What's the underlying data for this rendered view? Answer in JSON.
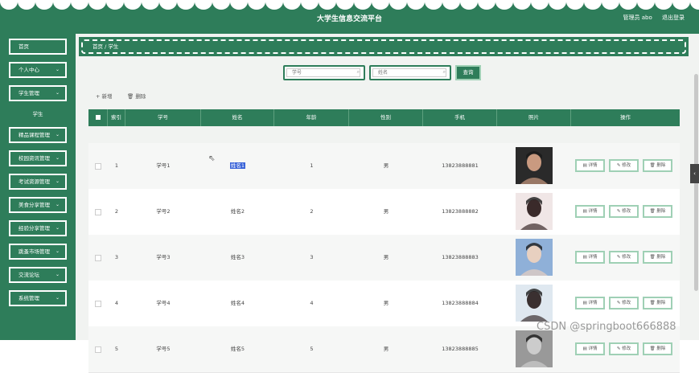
{
  "header": {
    "title": "大学生信息交流平台",
    "user_label": "管理员 abo",
    "logout_label": "退出登录"
  },
  "sidebar": {
    "items": [
      {
        "label": "首页",
        "chevron": ""
      },
      {
        "label": "个人中心",
        "chevron": "⌄"
      },
      {
        "label": "学生管理",
        "chevron": "⌄"
      },
      {
        "label": "精品课程管理",
        "chevron": "⌄"
      },
      {
        "label": "校园资讯管理",
        "chevron": "⌄"
      },
      {
        "label": "考试资源管理",
        "chevron": "⌄"
      },
      {
        "label": "美食分享管理",
        "chevron": "⌄"
      },
      {
        "label": "经验分享管理",
        "chevron": "⌄"
      },
      {
        "label": "跳蚤市场管理",
        "chevron": "⌄"
      },
      {
        "label": "交流论坛",
        "chevron": "⌄"
      },
      {
        "label": "系统管理",
        "chevron": "⌄"
      }
    ],
    "sub_item": "学生"
  },
  "breadcrumb": "首页 / 学生",
  "search": {
    "student_no_placeholder": "学号",
    "name_placeholder": "姓名",
    "query_label": "查询"
  },
  "toolbar": {
    "add_label": "+ 新增",
    "delete_label": "🗑 删除"
  },
  "table": {
    "headers": [
      "索引",
      "学号",
      "姓名",
      "年龄",
      "性别",
      "手机",
      "照片",
      "操作"
    ],
    "rows": [
      {
        "index": "1",
        "student_no": "学号1",
        "name": "姓名1",
        "age": "1",
        "gender": "男",
        "phone": "13823888881"
      },
      {
        "index": "2",
        "student_no": "学号2",
        "name": "姓名2",
        "age": "2",
        "gender": "男",
        "phone": "13823888882"
      },
      {
        "index": "3",
        "student_no": "学号3",
        "name": "姓名3",
        "age": "3",
        "gender": "男",
        "phone": "13823888883"
      },
      {
        "index": "4",
        "student_no": "学号4",
        "name": "姓名4",
        "age": "4",
        "gender": "男",
        "phone": "13823888884"
      },
      {
        "index": "5",
        "student_no": "学号5",
        "name": "姓名5",
        "age": "5",
        "gender": "男",
        "phone": "13823888885"
      }
    ],
    "actions": {
      "detail": "▤ 详情",
      "edit": "✎ 修改",
      "delete": "🗑 删除"
    }
  },
  "watermark": "CSDN @springboot666888",
  "colors": {
    "primary": "#2e7d5a",
    "accent_border": "#9fd0b5",
    "highlight": "#3a64d8"
  }
}
